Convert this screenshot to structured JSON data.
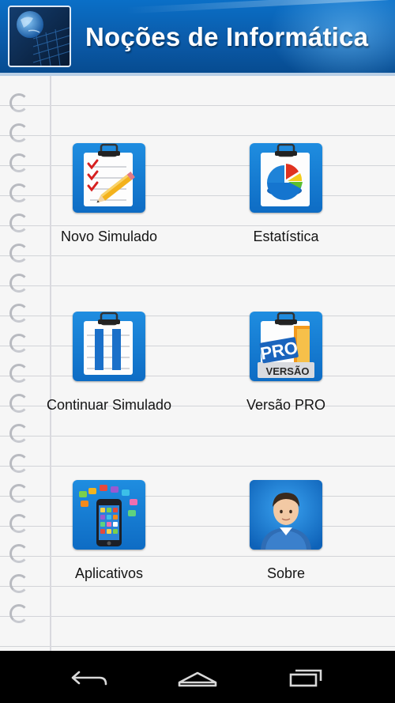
{
  "app": {
    "title": "Noções de Informática"
  },
  "menu": {
    "items": [
      {
        "label": "Novo Simulado",
        "icon": "checklist-pencil-icon"
      },
      {
        "label": "Estatística",
        "icon": "pie-chart-icon"
      },
      {
        "label": "Continuar Simulado",
        "icon": "pause-document-icon"
      },
      {
        "label": "Versão PRO",
        "icon": "pro-badge-icon"
      },
      {
        "label": "Aplicativos",
        "icon": "smartphone-apps-icon"
      },
      {
        "label": "Sobre",
        "icon": "user-profile-icon"
      }
    ],
    "pro_badge_top": "PRO",
    "pro_badge_bottom": "VERSÃO"
  },
  "navbar": {
    "buttons": [
      "back",
      "home",
      "recent-apps"
    ]
  },
  "colors": {
    "header": "#0b5aa8",
    "tile": "#1579d2",
    "navbar": "#000000"
  }
}
